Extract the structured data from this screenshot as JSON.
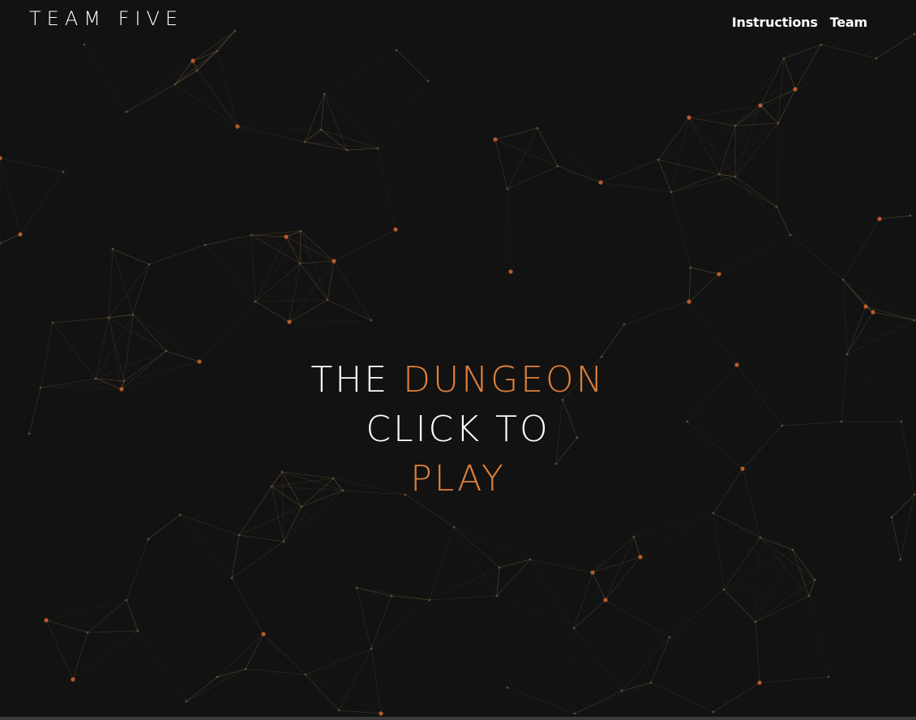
{
  "brand": {
    "logo_text": "TEAM FIVE",
    "logo_alt": "Team Five logo"
  },
  "nav": {
    "items": [
      {
        "label": "Instructions"
      },
      {
        "label": "Team"
      }
    ]
  },
  "hero": {
    "line1_word1": "THE",
    "line1_word2": "DUNGEON",
    "line2": "CLICK TO",
    "line3": "PLAY"
  },
  "colors": {
    "background": "#121212",
    "accent": "#e0803a",
    "text": "#ffffff",
    "node_dot": "#c8642a",
    "link_line": "#6e5a3a"
  },
  "background_art": {
    "icon": "particle-network-background"
  }
}
